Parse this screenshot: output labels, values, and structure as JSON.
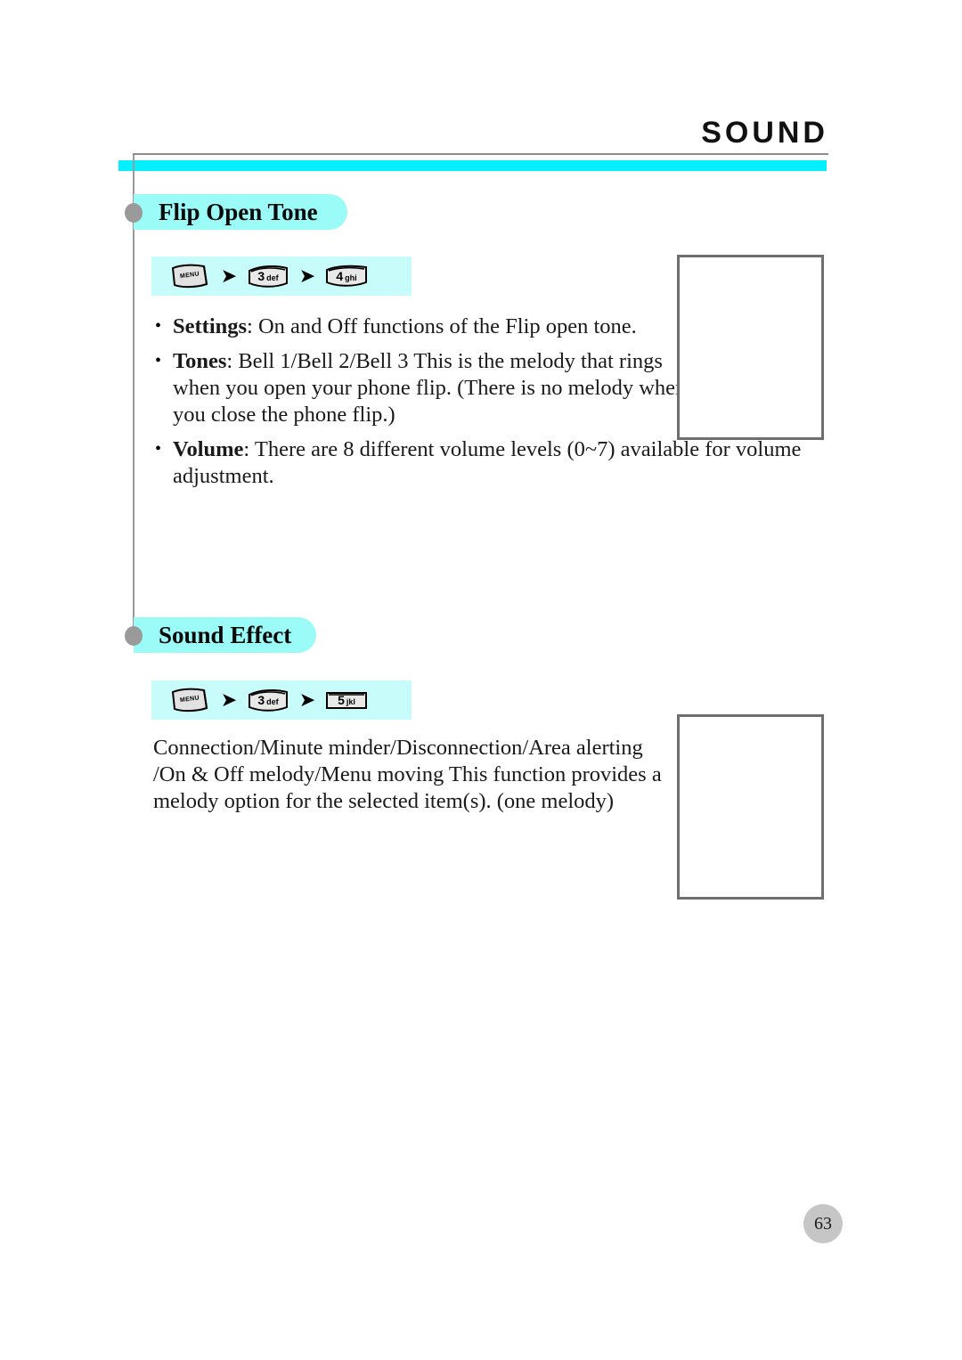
{
  "header": {
    "title": "SOUND"
  },
  "sections": [
    {
      "heading": "Flip Open Tone",
      "key_sequence": [
        {
          "type": "menu",
          "label": "MENU",
          "icon": "menu-key-icon"
        },
        {
          "type": "arrow",
          "label": "➤",
          "icon": "arrow-right-icon"
        },
        {
          "type": "num",
          "num": "3",
          "sub": "def",
          "icon": "key-3-def-icon"
        },
        {
          "type": "arrow",
          "label": "➤",
          "icon": "arrow-right-icon"
        },
        {
          "type": "num",
          "num": "4",
          "sub": "ghi",
          "icon": "key-4-ghi-icon"
        }
      ],
      "bullets": [
        {
          "term": "Settings",
          "text": ": On and Off functions of the Flip open tone."
        },
        {
          "term": "Tones",
          "text": ": Bell 1/Bell 2/Bell 3 This is the melody that rings when you open your phone flip. (There is no melody when you close the phone flip.)"
        },
        {
          "term": "Volume",
          "text": ": There are 8 different volume levels (0~7) available for volume adjustment."
        }
      ]
    },
    {
      "heading": "Sound Effect",
      "key_sequence": [
        {
          "type": "menu",
          "label": "MENU",
          "icon": "menu-key-icon"
        },
        {
          "type": "arrow",
          "label": "➤",
          "icon": "arrow-right-icon"
        },
        {
          "type": "num",
          "num": "3",
          "sub": "def",
          "icon": "key-3-def-icon"
        },
        {
          "type": "arrow",
          "label": "➤",
          "icon": "arrow-right-icon"
        },
        {
          "type": "num",
          "num": "5",
          "sub": "jkl",
          "icon": "key-5-jkl-icon"
        }
      ],
      "paragraph": "Connection/Minute minder/Disconnection/Area alerting /On & Off melody/Menu moving This function provides a melody option for the selected item(s). (one melody)"
    }
  ],
  "illustrations": [
    {
      "name": "phone-screen-placeholder-1"
    },
    {
      "name": "phone-screen-placeholder-2"
    }
  ],
  "footer": {
    "page_number": "63"
  },
  "colors": {
    "cyan_bar": "#00f0ff",
    "heading_pill": "#9bfbf7",
    "key_strip": "#c8fcfb",
    "spine": "#9a9a9a",
    "box_border": "#6e6e6e",
    "page_badge": "#c6c6c6"
  }
}
